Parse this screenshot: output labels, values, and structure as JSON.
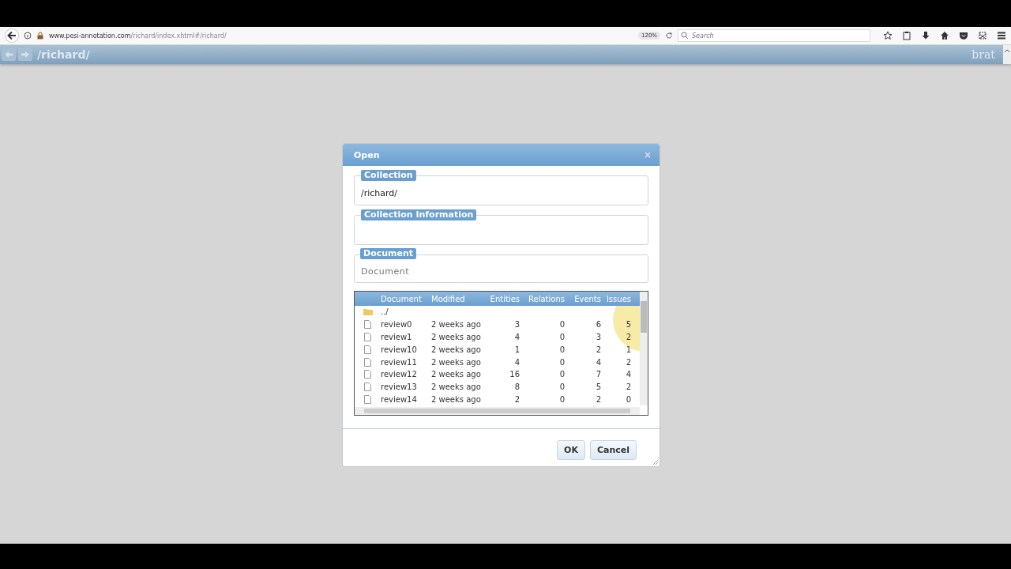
{
  "browser": {
    "url_domain": "www.pesi-annotation.com",
    "url_path": "/richard/index.xhtml#/richard/",
    "zoom": "120%",
    "search_placeholder": "Search"
  },
  "app_header": {
    "path": "/richard/",
    "logo": "brat"
  },
  "dialog": {
    "title": "Open",
    "close": "×",
    "collection": {
      "legend": "Collection",
      "value": "/richard/"
    },
    "collection_info": {
      "legend": "Collection Information"
    },
    "document": {
      "legend": "Document",
      "placeholder": "Document"
    },
    "table": {
      "columns": [
        "Document",
        "Modified",
        "Entities",
        "Relations",
        "Events",
        "Issues"
      ],
      "rows": [
        {
          "kind": "folder",
          "cells": [
            "../",
            "",
            "",
            "",
            "",
            ""
          ]
        },
        {
          "kind": "file",
          "cells": [
            "review0",
            "2 weeks ago",
            "3",
            "0",
            "6",
            "5"
          ]
        },
        {
          "kind": "file",
          "cells": [
            "review1",
            "2 weeks ago",
            "4",
            "0",
            "3",
            "2"
          ]
        },
        {
          "kind": "file",
          "cells": [
            "review10",
            "2 weeks ago",
            "1",
            "0",
            "2",
            "1"
          ]
        },
        {
          "kind": "file",
          "cells": [
            "review11",
            "2 weeks ago",
            "4",
            "0",
            "4",
            "2"
          ]
        },
        {
          "kind": "file",
          "cells": [
            "review12",
            "2 weeks ago",
            "16",
            "0",
            "7",
            "4"
          ]
        },
        {
          "kind": "file",
          "cells": [
            "review13",
            "2 weeks ago",
            "8",
            "0",
            "5",
            "2"
          ]
        },
        {
          "kind": "file",
          "cells": [
            "review14",
            "2 weeks ago",
            "2",
            "0",
            "2",
            "0"
          ]
        }
      ]
    },
    "buttons": [
      "OK",
      "Cancel"
    ]
  }
}
